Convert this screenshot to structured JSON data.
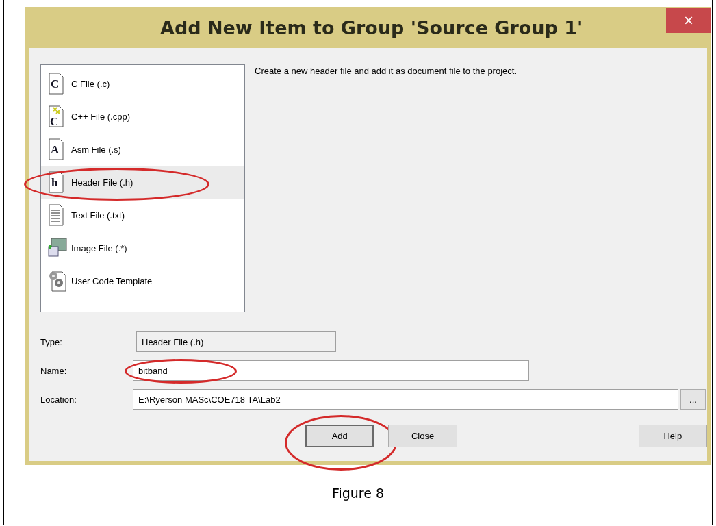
{
  "window": {
    "title": "Add New Item to Group 'Source Group 1'",
    "close": "×"
  },
  "file_types": [
    {
      "label": "C File (.c)",
      "kind": "c",
      "glyph": "C",
      "selected": false,
      "circled": false
    },
    {
      "label": "C++ File (.cpp)",
      "kind": "cpp",
      "glyph": "C",
      "selected": false,
      "circled": false
    },
    {
      "label": "Asm File (.s)",
      "kind": "asm",
      "glyph": "A",
      "selected": false,
      "circled": false
    },
    {
      "label": "Header File (.h)",
      "kind": "header",
      "glyph": "h",
      "selected": true,
      "circled": true
    },
    {
      "label": "Text File (.txt)",
      "kind": "text",
      "selected": false,
      "circled": false
    },
    {
      "label": "Image File (.*)",
      "kind": "image",
      "selected": false,
      "circled": false
    },
    {
      "label": "User Code Template",
      "kind": "template",
      "selected": false,
      "circled": false
    }
  ],
  "description": "Create a new header file and add it as document file to the project.",
  "fields": [
    {
      "label": "Type:",
      "value": "Header File (.h)",
      "kind": "readonly",
      "circled": false
    },
    {
      "label": "Name:",
      "value": "bitband",
      "kind": "name",
      "circled": true
    },
    {
      "label": "Location:",
      "value": "E:\\Ryerson MASc\\COE718 TA\\Lab2",
      "kind": "path",
      "circled": false,
      "browse": "..."
    }
  ],
  "buttons": [
    {
      "label": "Add",
      "default": true,
      "circled": true
    },
    {
      "label": "Close",
      "default": false,
      "circled": false
    },
    {
      "label": "Help",
      "default": false,
      "circled": false
    }
  ],
  "caption": "Figure 8"
}
